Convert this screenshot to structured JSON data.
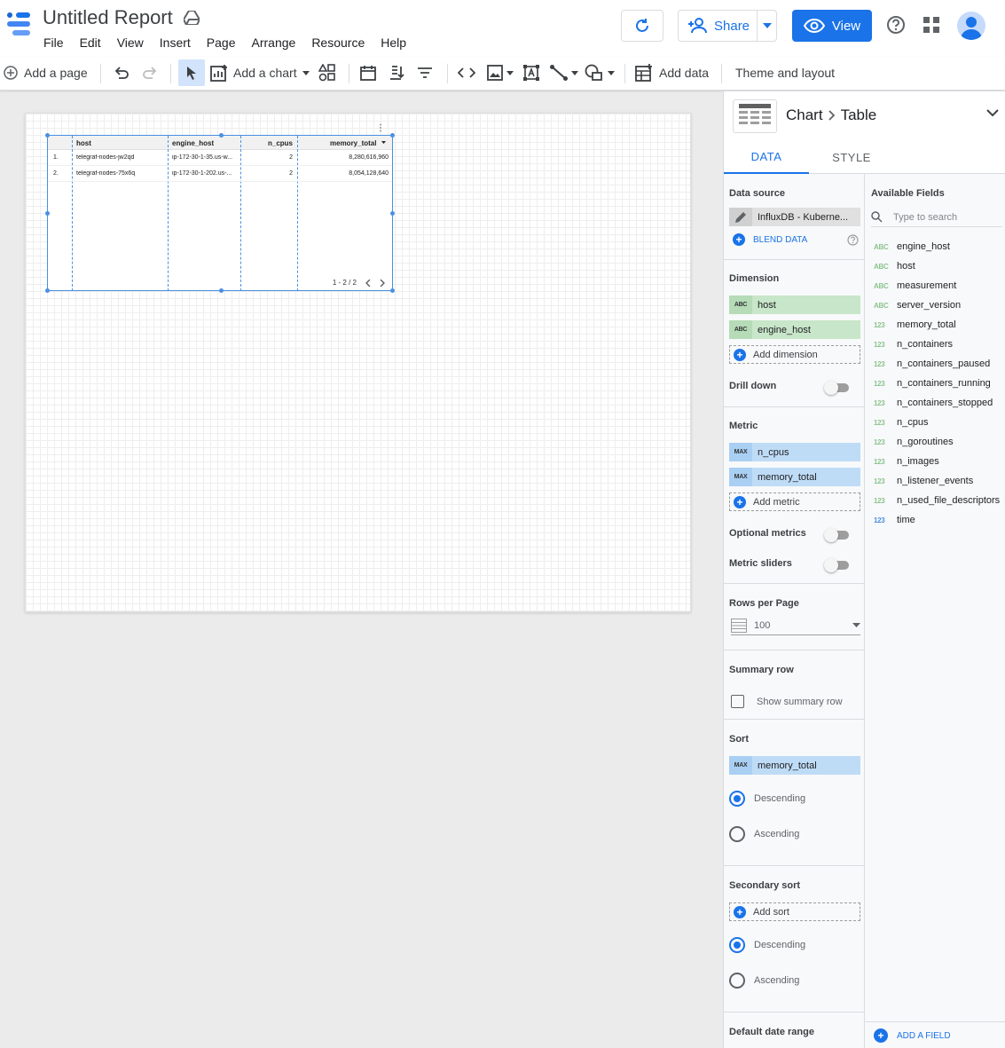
{
  "header": {
    "title": "Untitled Report",
    "menu": [
      "File",
      "Edit",
      "View",
      "Insert",
      "Page",
      "Arrange",
      "Resource",
      "Help"
    ],
    "share_label": "Share",
    "view_label": "View"
  },
  "toolbar": {
    "add_page": "Add a page",
    "add_chart": "Add a chart",
    "add_data": "Add data",
    "theme_layout": "Theme and layout"
  },
  "table": {
    "columns": [
      "host",
      "engine_host",
      "n_cpus",
      "memory_total"
    ],
    "rows": [
      {
        "index": "1.",
        "host": "telegraf-nodes-jw2qd",
        "engine_host": "ip-172-30-1-35.us-w...",
        "n_cpus": "2",
        "memory_total": "8,280,616,960"
      },
      {
        "index": "2.",
        "host": "telegraf-nodes-75x6q",
        "engine_host": "ip-172-30-1-202.us-...",
        "n_cpus": "2",
        "memory_total": "8,054,128,640"
      }
    ],
    "pagination": "1 - 2 / 2"
  },
  "panel": {
    "crumb_chart": "Chart",
    "crumb_type": "Table",
    "tab_data": "DATA",
    "tab_style": "STYLE",
    "data_source_title": "Data source",
    "data_source": "InfluxDB - Kuberne...",
    "blend_data": "BLEND DATA",
    "dimension_title": "Dimension",
    "dimensions": [
      "host",
      "engine_host"
    ],
    "dimension_tag": "ABC",
    "add_dimension": "Add dimension",
    "drill_down": "Drill down",
    "metric_title": "Metric",
    "metrics": [
      "n_cpus",
      "memory_total"
    ],
    "metric_tag": "MAX",
    "add_metric": "Add metric",
    "optional_metrics": "Optional metrics",
    "metric_sliders": "Metric sliders",
    "rows_per_page_title": "Rows per Page",
    "rows_per_page": "100",
    "summary_row_title": "Summary row",
    "show_summary_row": "Show summary row",
    "sort_title": "Sort",
    "sort_field": "memory_total",
    "descending": "Descending",
    "ascending": "Ascending",
    "secondary_sort_title": "Secondary sort",
    "add_sort": "Add sort",
    "default_date_range": "Default date range",
    "available_fields_title": "Available Fields",
    "search_placeholder": "Type to search",
    "add_field": "ADD A FIELD",
    "fields": [
      {
        "type": "ABC",
        "name": "engine_host"
      },
      {
        "type": "ABC",
        "name": "host"
      },
      {
        "type": "ABC",
        "name": "measurement"
      },
      {
        "type": "ABC",
        "name": "server_version"
      },
      {
        "type": "123",
        "name": "memory_total"
      },
      {
        "type": "123",
        "name": "n_containers"
      },
      {
        "type": "123",
        "name": "n_containers_paused"
      },
      {
        "type": "123",
        "name": "n_containers_running"
      },
      {
        "type": "123",
        "name": "n_containers_stopped"
      },
      {
        "type": "123",
        "name": "n_cpus"
      },
      {
        "type": "123",
        "name": "n_goroutines"
      },
      {
        "type": "123",
        "name": "n_images"
      },
      {
        "type": "123",
        "name": "n_listener_events"
      },
      {
        "type": "123",
        "name": "n_used_file_descriptors"
      },
      {
        "type": "123",
        "name": "time"
      }
    ]
  },
  "colors": {
    "accent": "#1a73e8",
    "dimension_chip": "#c8e6c9",
    "metric_chip": "#bfdcf7",
    "selection": "#4a90e2"
  }
}
